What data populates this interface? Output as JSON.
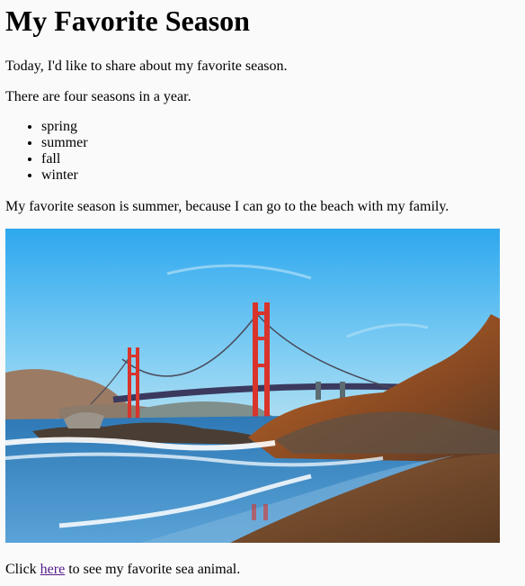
{
  "heading": "My Favorite Season",
  "intro": "Today, I'd like to share about my favorite season.",
  "seasons_intro": "There are four seasons in a year.",
  "seasons": [
    "spring",
    "summer",
    "fall",
    "winter"
  ],
  "favorite": "My favorite season is summer, because I can go to the beach with my family.",
  "footer": {
    "before": "Click ",
    "link_text": "here",
    "after": " to see my favorite sea animal."
  },
  "colors": {
    "visited_link": "#551a8b",
    "bridge": "#d9342b",
    "sky": "#3fb4ef"
  }
}
